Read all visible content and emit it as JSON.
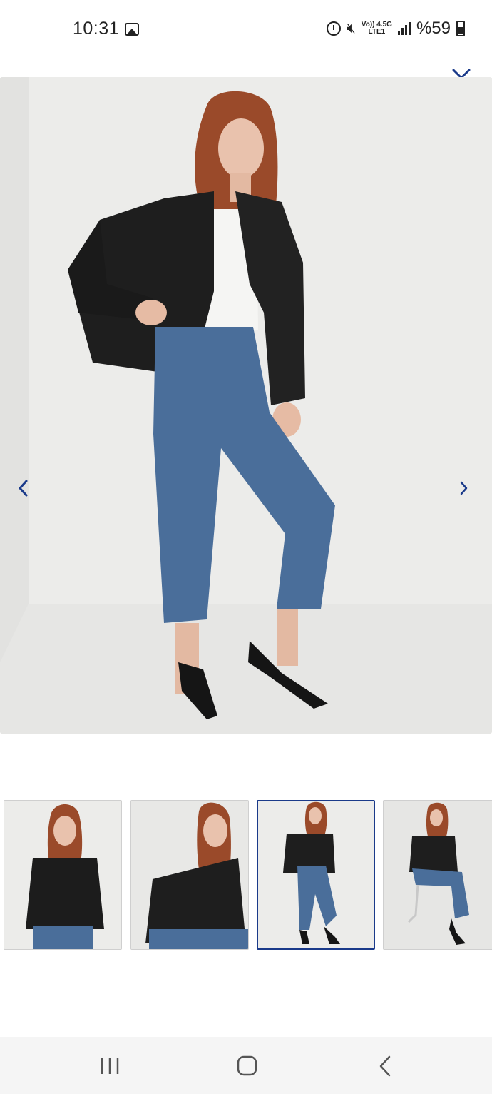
{
  "status_bar": {
    "time": "10:31",
    "network_top": "Vo)) 4.5G",
    "network_bottom": "LTE1",
    "battery": "%59",
    "icons": [
      "gallery-icon",
      "alarm-icon",
      "mute-icon",
      "signal-icon",
      "battery-icon"
    ]
  },
  "viewer": {
    "close_icon": "close-icon",
    "prev_icon": "chevron-left-icon",
    "next_icon": "chevron-right-icon",
    "accent_color": "#1a3a8a",
    "selected_index": 2
  },
  "thumbnails": [
    {
      "name": "thumbnail-front-closeup"
    },
    {
      "name": "thumbnail-seated-closeup"
    },
    {
      "name": "thumbnail-full-standing"
    },
    {
      "name": "thumbnail-seated-chair"
    }
  ],
  "system_nav": {
    "recents_icon": "recents-icon",
    "home_icon": "home-icon",
    "back_icon": "back-icon"
  }
}
